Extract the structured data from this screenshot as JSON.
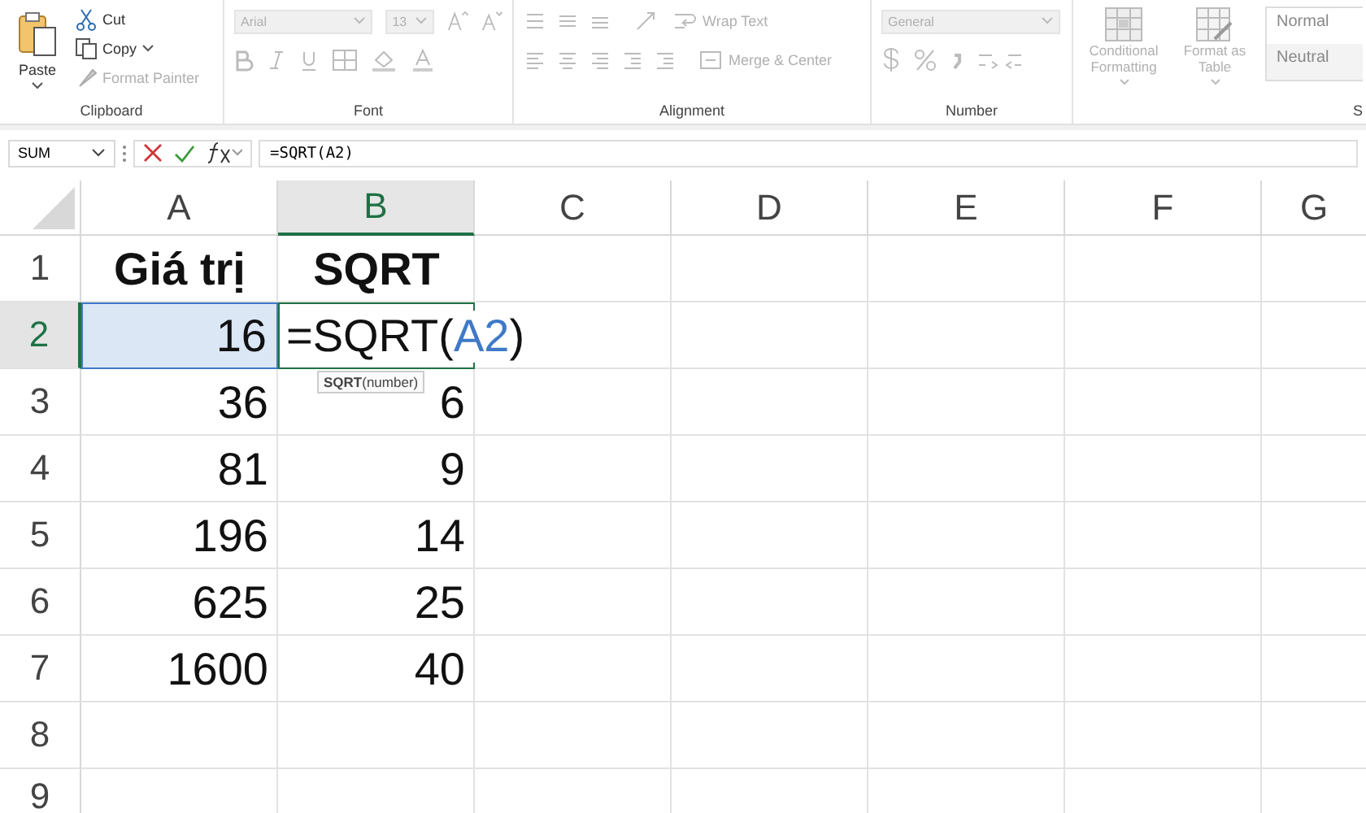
{
  "ribbon": {
    "clipboard": {
      "label": "Clipboard",
      "paste": {
        "label": "Paste",
        "disabled": false
      },
      "cut": {
        "label": "Cut",
        "disabled": false
      },
      "copy": {
        "label": "Copy",
        "disabled": false
      },
      "format_painter": {
        "label": "Format Painter",
        "disabled": true
      }
    },
    "font": {
      "label": "Font",
      "disabled": true,
      "font_name": "Arial",
      "font_size": "13"
    },
    "alignment": {
      "label": "Alignment",
      "disabled": true,
      "wrap_text": "Wrap Text",
      "merge_center": "Merge & Center"
    },
    "number": {
      "label": "Number",
      "disabled": true,
      "format": "General"
    },
    "styles": {
      "label": "S",
      "disabled": true,
      "conditional_formatting": "Conditional Formatting",
      "format_as_table": "Format as Table",
      "cell_styles": [
        "Normal",
        "Neutral"
      ]
    }
  },
  "formula_bar": {
    "name_box": "SUM",
    "formula": "=SQRT(A2)"
  },
  "columns": [
    {
      "label": "A",
      "selected": false
    },
    {
      "label": "B",
      "selected": true
    },
    {
      "label": "C",
      "selected": false
    },
    {
      "label": "D",
      "selected": false
    },
    {
      "label": "E",
      "selected": false
    },
    {
      "label": "F",
      "selected": false
    },
    {
      "label": "G",
      "selected": false
    }
  ],
  "rows": [
    {
      "label": "1",
      "selected": false,
      "cells": [
        {
          "kind": "header",
          "text": "Giá trị"
        },
        {
          "kind": "header",
          "text": "SQRT"
        }
      ]
    },
    {
      "label": "2",
      "selected": true,
      "cells": [
        {
          "kind": "referenced",
          "text": "16"
        },
        {
          "kind": "editing",
          "parts": [
            {
              "kind": "text",
              "text": "=SQRT("
            },
            {
              "kind": "ref",
              "text": "A2"
            },
            {
              "kind": "text",
              "text": ")"
            }
          ],
          "tooltip": "**SQRT**(number)"
        }
      ]
    },
    {
      "label": "3",
      "selected": false,
      "cells": [
        {
          "kind": "number",
          "text": "36"
        },
        {
          "kind": "number",
          "text": "6"
        }
      ]
    },
    {
      "label": "4",
      "selected": false,
      "cells": [
        {
          "kind": "number",
          "text": "81"
        },
        {
          "kind": "number",
          "text": "9"
        }
      ]
    },
    {
      "label": "5",
      "selected": false,
      "cells": [
        {
          "kind": "number",
          "text": "196"
        },
        {
          "kind": "number",
          "text": "14"
        }
      ]
    },
    {
      "label": "6",
      "selected": false,
      "cells": [
        {
          "kind": "number",
          "text": "625"
        },
        {
          "kind": "number",
          "text": "25"
        }
      ]
    },
    {
      "label": "7",
      "selected": false,
      "cells": [
        {
          "kind": "number",
          "text": "1600"
        },
        {
          "kind": "number",
          "text": "40"
        }
      ]
    },
    {
      "label": "8",
      "selected": false,
      "cells": []
    },
    {
      "label": "9",
      "selected": false,
      "cells": []
    }
  ]
}
